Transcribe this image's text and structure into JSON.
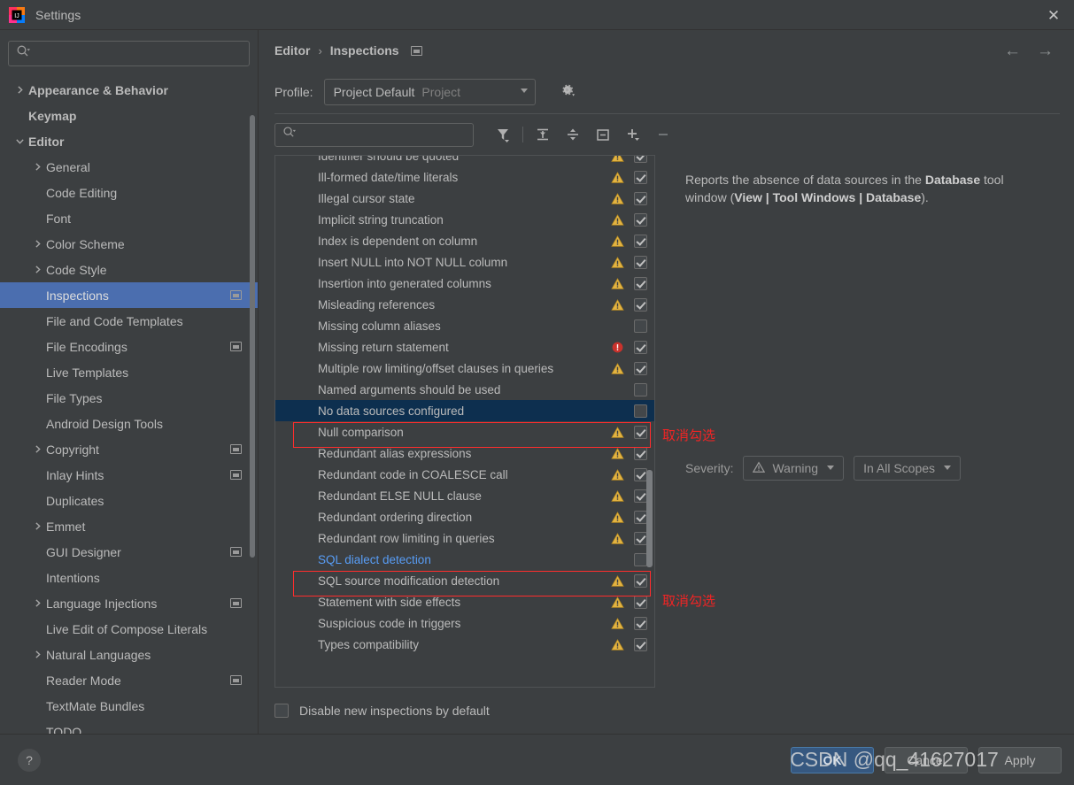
{
  "window": {
    "title": "Settings",
    "app_icon": "intellij-idea-icon",
    "close_label": "✕"
  },
  "sidebar": {
    "search": {
      "placeholder": "",
      "value": "",
      "icon": "search-icon"
    },
    "items": [
      {
        "label": "Appearance & Behavior",
        "level": 0,
        "arrow": "chevron-right",
        "bold": true,
        "indicator": false,
        "selected": false
      },
      {
        "label": "Keymap",
        "level": 0,
        "arrow": "none",
        "bold": true,
        "indicator": false,
        "selected": false
      },
      {
        "label": "Editor",
        "level": 0,
        "arrow": "chevron-down",
        "bold": true,
        "indicator": false,
        "selected": false
      },
      {
        "label": "General",
        "level": 1,
        "arrow": "chevron-right",
        "bold": false,
        "indicator": false,
        "selected": false
      },
      {
        "label": "Code Editing",
        "level": 1,
        "arrow": "none",
        "bold": false,
        "indicator": false,
        "selected": false
      },
      {
        "label": "Font",
        "level": 1,
        "arrow": "none",
        "bold": false,
        "indicator": false,
        "selected": false
      },
      {
        "label": "Color Scheme",
        "level": 1,
        "arrow": "chevron-right",
        "bold": false,
        "indicator": false,
        "selected": false
      },
      {
        "label": "Code Style",
        "level": 1,
        "arrow": "chevron-right",
        "bold": false,
        "indicator": false,
        "selected": false
      },
      {
        "label": "Inspections",
        "level": 1,
        "arrow": "none",
        "bold": false,
        "indicator": true,
        "selected": true
      },
      {
        "label": "File and Code Templates",
        "level": 1,
        "arrow": "none",
        "bold": false,
        "indicator": false,
        "selected": false
      },
      {
        "label": "File Encodings",
        "level": 1,
        "arrow": "none",
        "bold": false,
        "indicator": true,
        "selected": false
      },
      {
        "label": "Live Templates",
        "level": 1,
        "arrow": "none",
        "bold": false,
        "indicator": false,
        "selected": false
      },
      {
        "label": "File Types",
        "level": 1,
        "arrow": "none",
        "bold": false,
        "indicator": false,
        "selected": false
      },
      {
        "label": "Android Design Tools",
        "level": 1,
        "arrow": "none",
        "bold": false,
        "indicator": false,
        "selected": false
      },
      {
        "label": "Copyright",
        "level": 1,
        "arrow": "chevron-right",
        "bold": false,
        "indicator": true,
        "selected": false
      },
      {
        "label": "Inlay Hints",
        "level": 1,
        "arrow": "none",
        "bold": false,
        "indicator": true,
        "selected": false
      },
      {
        "label": "Duplicates",
        "level": 1,
        "arrow": "none",
        "bold": false,
        "indicator": false,
        "selected": false
      },
      {
        "label": "Emmet",
        "level": 1,
        "arrow": "chevron-right",
        "bold": false,
        "indicator": false,
        "selected": false
      },
      {
        "label": "GUI Designer",
        "level": 1,
        "arrow": "none",
        "bold": false,
        "indicator": true,
        "selected": false
      },
      {
        "label": "Intentions",
        "level": 1,
        "arrow": "none",
        "bold": false,
        "indicator": false,
        "selected": false
      },
      {
        "label": "Language Injections",
        "level": 1,
        "arrow": "chevron-right",
        "bold": false,
        "indicator": true,
        "selected": false
      },
      {
        "label": "Live Edit of Compose Literals",
        "level": 1,
        "arrow": "none",
        "bold": false,
        "indicator": false,
        "selected": false
      },
      {
        "label": "Natural Languages",
        "level": 1,
        "arrow": "chevron-right",
        "bold": false,
        "indicator": false,
        "selected": false
      },
      {
        "label": "Reader Mode",
        "level": 1,
        "arrow": "none",
        "bold": false,
        "indicator": true,
        "selected": false
      },
      {
        "label": "TextMate Bundles",
        "level": 1,
        "arrow": "none",
        "bold": false,
        "indicator": false,
        "selected": false
      },
      {
        "label": "TODO",
        "level": 1,
        "arrow": "none",
        "bold": false,
        "indicator": false,
        "selected": false
      }
    ]
  },
  "main": {
    "breadcrumb": {
      "root": "Editor",
      "separator": "›",
      "current": "Inspections",
      "indicator": "copy-indicator"
    },
    "nav": {
      "back": "←",
      "forward": "→"
    },
    "profile": {
      "label": "Profile:",
      "value": "Project Default",
      "scope": "Project",
      "arrow": "chevron-down-icon",
      "gear": "gear-icon"
    },
    "toolbar": {
      "filter_search": {
        "placeholder": "",
        "value": "",
        "icon": "search-icon"
      },
      "buttons": [
        {
          "name": "filter-button",
          "icon": "funnel-icon"
        },
        {
          "name": "expand-all-button",
          "icon": "expand-all-icon"
        },
        {
          "name": "collapse-all-button",
          "icon": "collapse-all-icon"
        },
        {
          "name": "reset-button",
          "icon": "minus-box-icon"
        },
        {
          "name": "add-button",
          "icon": "plus-icon"
        },
        {
          "name": "remove-button",
          "icon": "minus-icon"
        }
      ]
    },
    "inspections": [
      {
        "label": "Identifier should be quoted",
        "severity": "warning",
        "checked": true,
        "selected": false,
        "link": false
      },
      {
        "label": "Ill-formed date/time literals",
        "severity": "warning",
        "checked": true,
        "selected": false,
        "link": false
      },
      {
        "label": "Illegal cursor state",
        "severity": "warning",
        "checked": true,
        "selected": false,
        "link": false
      },
      {
        "label": "Implicit string truncation",
        "severity": "warning",
        "checked": true,
        "selected": false,
        "link": false
      },
      {
        "label": "Index is dependent on column",
        "severity": "warning",
        "checked": true,
        "selected": false,
        "link": false
      },
      {
        "label": "Insert NULL into NOT NULL column",
        "severity": "warning",
        "checked": true,
        "selected": false,
        "link": false
      },
      {
        "label": "Insertion into generated columns",
        "severity": "warning",
        "checked": true,
        "selected": false,
        "link": false
      },
      {
        "label": "Misleading references",
        "severity": "warning",
        "checked": true,
        "selected": false,
        "link": false
      },
      {
        "label": "Missing column aliases",
        "severity": "none",
        "checked": false,
        "selected": false,
        "link": false
      },
      {
        "label": "Missing return statement",
        "severity": "error",
        "checked": true,
        "selected": false,
        "link": false
      },
      {
        "label": "Multiple row limiting/offset clauses in queries",
        "severity": "warning",
        "checked": true,
        "selected": false,
        "link": false
      },
      {
        "label": "Named arguments should be used",
        "severity": "none",
        "checked": false,
        "selected": false,
        "link": false
      },
      {
        "label": "No data sources configured",
        "severity": "none",
        "checked": false,
        "selected": true,
        "link": false
      },
      {
        "label": "Null comparison",
        "severity": "warning",
        "checked": true,
        "selected": false,
        "link": false
      },
      {
        "label": "Redundant alias expressions",
        "severity": "warning",
        "checked": true,
        "selected": false,
        "link": false
      },
      {
        "label": "Redundant code in COALESCE call",
        "severity": "warning",
        "checked": true,
        "selected": false,
        "link": false
      },
      {
        "label": "Redundant ELSE NULL clause",
        "severity": "warning",
        "checked": true,
        "selected": false,
        "link": false
      },
      {
        "label": "Redundant ordering direction",
        "severity": "warning",
        "checked": true,
        "selected": false,
        "link": false
      },
      {
        "label": "Redundant row limiting in queries",
        "severity": "warning",
        "checked": true,
        "selected": false,
        "link": false
      },
      {
        "label": "SQL dialect detection",
        "severity": "none",
        "checked": false,
        "selected": false,
        "link": true
      },
      {
        "label": "SQL source modification detection",
        "severity": "warning",
        "checked": true,
        "selected": false,
        "link": false
      },
      {
        "label": "Statement with side effects",
        "severity": "warning",
        "checked": true,
        "selected": false,
        "link": false
      },
      {
        "label": "Suspicious code in triggers",
        "severity": "warning",
        "checked": true,
        "selected": false,
        "link": false
      },
      {
        "label": "Types compatibility",
        "severity": "warning",
        "checked": true,
        "selected": false,
        "link": false
      }
    ],
    "description": {
      "part1": "Reports the absence of data sources in the ",
      "bold1": "Database",
      "part2": " tool window (",
      "bold2": "View | Tool Windows | Database",
      "part3": ")."
    },
    "severity": {
      "label": "Severity:",
      "value": "Warning",
      "icon": "warning-triangle-icon",
      "arrow": "chevron-down-icon",
      "scope": "In All Scopes",
      "scope_arrow": "chevron-down-icon"
    },
    "disable_new": {
      "label": "Disable new inspections by default",
      "checked": false
    }
  },
  "footer": {
    "help": "?",
    "ok": "OK",
    "cancel": "Cancel",
    "apply": "Apply"
  },
  "annotations": {
    "note1": "取消勾选",
    "note2": "取消勾选",
    "watermark": "CSDN @qq_41627017",
    "box_color": "#ff2d2d"
  }
}
